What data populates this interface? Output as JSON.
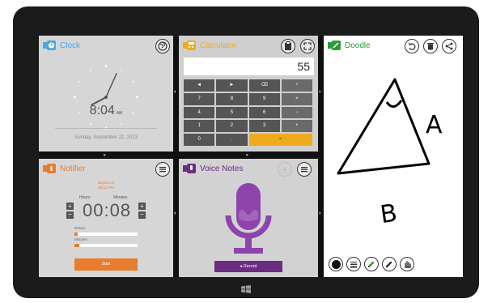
{
  "colors": {
    "clock_accent": "#4aa7e0",
    "calculator_accent": "#f0ab1c",
    "doodle_accent": "#2d9a3e",
    "notifier_accent": "#e67d2f",
    "voice_accent": "#6b2d83",
    "voice_mic": "#8e44ad"
  },
  "clock": {
    "title": "Clock",
    "time": "8:04",
    "ampm": "AM",
    "date": "Sunday, September 22, 2013",
    "hour": 8,
    "minute": 4,
    "icon": "globe-icon"
  },
  "calculator": {
    "title": "Calculator",
    "display": "55",
    "keys": [
      [
        "◄",
        "►",
        "⌫",
        "÷"
      ],
      [
        "7",
        "8",
        "9",
        "×"
      ],
      [
        "4",
        "5",
        "6",
        "−"
      ],
      [
        "1",
        "2",
        "3",
        "+"
      ],
      [
        "0",
        ".",
        "="
      ]
    ],
    "icons": [
      "clipboard-icon",
      "resize-icon"
    ]
  },
  "doodle": {
    "title": "Doodle",
    "drawing_labels": [
      "A",
      "B"
    ],
    "top_icons": [
      "undo-icon",
      "trash-icon",
      "share-icon"
    ],
    "tool_icons": [
      "brush-size-icon",
      "stroke-width-icon",
      "pen-color-icon",
      "eraser-icon",
      "hand-pan-icon"
    ]
  },
  "notifier": {
    "title": "Notifier",
    "expires_at": "Expires at",
    "expires_time": "08:13 PM",
    "hours_label": "Hours",
    "minutes_label": "Minutes",
    "hours_value": "00",
    "minutes_value": "08",
    "return_label": "Return",
    "minutes_slider_label": "Minutes",
    "start_label": "Start",
    "return_level": 0.05,
    "minutes_level": 0.08
  },
  "voice": {
    "title": "Voice Notes",
    "record_label": "● Record",
    "icons": [
      "add-icon",
      "menu-icon"
    ]
  },
  "taskbar": {
    "home_icon": "windows-logo-icon"
  }
}
